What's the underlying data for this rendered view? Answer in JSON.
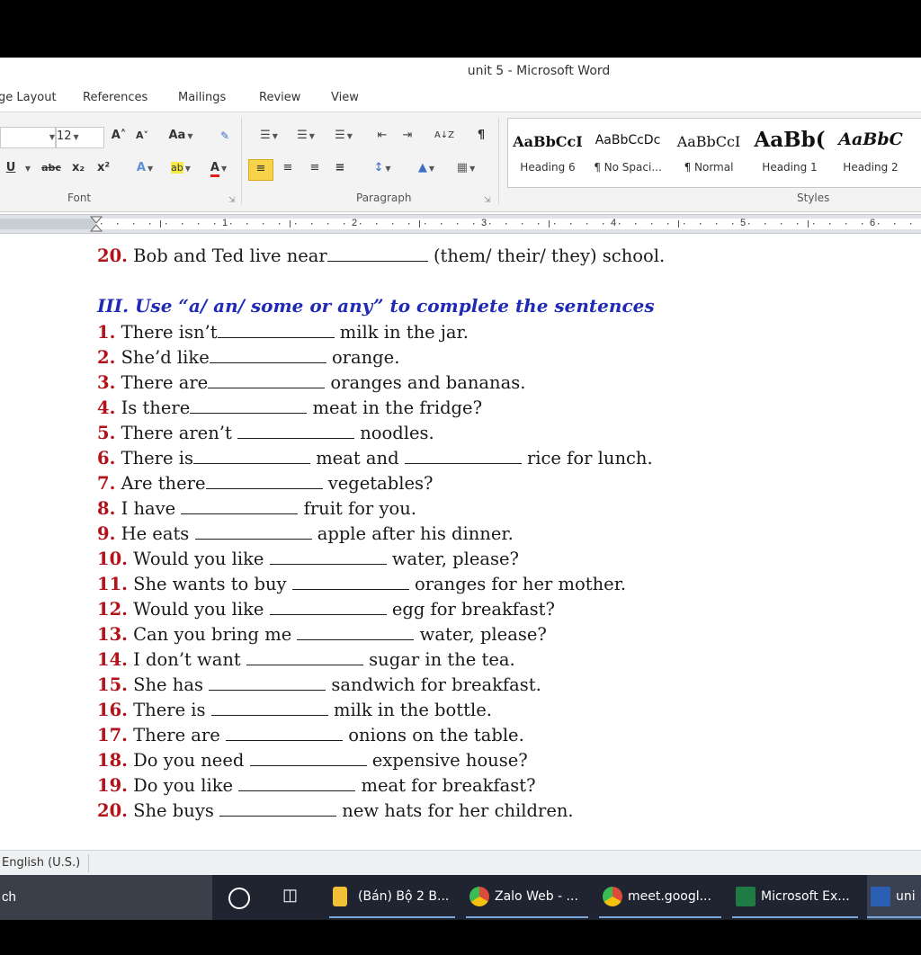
{
  "window": {
    "title": "unit 5 - Microsoft Word"
  },
  "ribbon_tabs": [
    "ge Layout",
    "References",
    "Mailings",
    "Review",
    "View"
  ],
  "ribbon": {
    "font_size": "12",
    "grow_font": "A˄",
    "shrink_font": "A˅",
    "change_case": "Aa",
    "underline": "U",
    "strikethrough": "abc",
    "subscript": "x₂",
    "superscript": "x²",
    "text_effects": "A",
    "highlight": "ab",
    "font_color": "A",
    "font_group": "Font",
    "paragraph_group": "Paragraph",
    "styles_group": "Styles",
    "pilcrow": "¶",
    "sort": "A↓Z",
    "styles": [
      {
        "sample": "AaBbCcI",
        "name": "Heading 6"
      },
      {
        "sample": "AaBbCcDc",
        "name": "¶ No Spaci..."
      },
      {
        "sample": "AaBbCcI",
        "name": "¶ Normal"
      },
      {
        "sample": "AaBb(",
        "name": "Heading 1"
      },
      {
        "sample": "AaBbC",
        "name": "Heading 2"
      }
    ]
  },
  "ruler": {
    "numbers": [
      "1",
      "2",
      "3",
      "4",
      "5",
      "6"
    ]
  },
  "document": {
    "prev_line": {
      "num": "20.",
      "before": "Bob and Ted live near",
      "after": "(them/ their/ they) school."
    },
    "section_heading": "III. Use “a/ an/ some or any” to complete the sentences",
    "items": [
      {
        "num": "1.",
        "before": "There isn’t",
        "after": "milk in the jar."
      },
      {
        "num": "2.",
        "before": "She’d like",
        "after": "orange."
      },
      {
        "num": "3.",
        "before": "There are",
        "after": "oranges and bananas."
      },
      {
        "num": "4.",
        "before": "Is there",
        "after": "meat in the fridge?"
      },
      {
        "num": "5.",
        "before": "There aren’t ",
        "after": "noodles."
      },
      {
        "num": "6.",
        "before": "There is",
        "after": "meat and",
        "after2": "rice for lunch."
      },
      {
        "num": "7.",
        "before": "Are there",
        "after": "vegetables?"
      },
      {
        "num": "8.",
        "before": "I have ",
        "after": "fruit for you."
      },
      {
        "num": "9.",
        "before": "He eats ",
        "after": "apple after his dinner."
      },
      {
        "num": "10.",
        "before": "Would you like ",
        "after": "water, please?"
      },
      {
        "num": "11.",
        "before": "She wants to buy ",
        "after": "oranges for her mother."
      },
      {
        "num": "12.",
        "before": "Would you like ",
        "after": "egg for breakfast?"
      },
      {
        "num": "13.",
        "before": "Can you bring me ",
        "after": "water, please?"
      },
      {
        "num": "14.",
        "before": "I don’t want ",
        "after": "sugar in the tea."
      },
      {
        "num": "15.",
        "before": "She has ",
        "after": "sandwich for breakfast."
      },
      {
        "num": "16.",
        "before": "There is ",
        "after": "milk in the bottle."
      },
      {
        "num": "17.",
        "before": "There are ",
        "after": "onions on the table."
      },
      {
        "num": "18.",
        "before": "Do you need ",
        "after": "expensive house?"
      },
      {
        "num": "19.",
        "before": "Do you like ",
        "after": "meat for breakfast?"
      },
      {
        "num": "20.",
        "before": "She buys ",
        "after": "new hats for her children."
      }
    ]
  },
  "statusbar": {
    "language": "English (U.S.)"
  },
  "taskbar": {
    "search_stub": "ch",
    "items": [
      {
        "label": "(Bán) Bộ 2 B...",
        "icon": "folder-icon",
        "color": "#f2c037"
      },
      {
        "label": "Zalo Web - ...",
        "icon": "chrome-icon",
        "color": "#dd4b39"
      },
      {
        "label": "meet.googl...",
        "icon": "chrome-icon",
        "color": "#dd4b39"
      },
      {
        "label": "Microsoft Ex...",
        "icon": "excel-icon",
        "color": "#1f7a43"
      },
      {
        "label": "uni",
        "icon": "word-icon",
        "color": "#2b5fb4"
      }
    ]
  },
  "colors": {
    "number_red": "#b3121b",
    "heading_blue": "#1f2bb5",
    "highlight_yellow": "#f7d34a"
  }
}
